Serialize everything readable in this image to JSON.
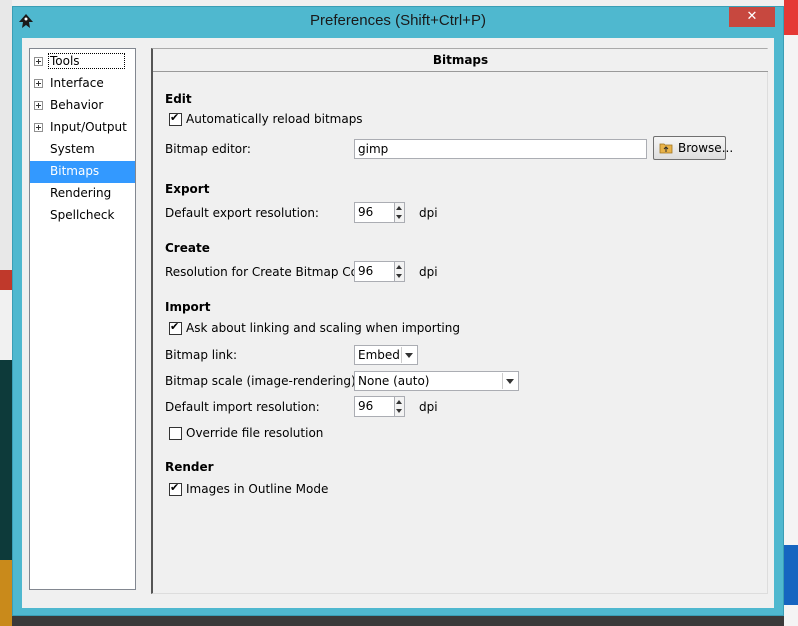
{
  "window": {
    "title": "Preferences (Shift+Ctrl+P)",
    "close_label": "✕"
  },
  "tree": {
    "items": [
      {
        "label": "Tools",
        "expandable": true
      },
      {
        "label": "Interface",
        "expandable": true
      },
      {
        "label": "Behavior",
        "expandable": true
      },
      {
        "label": "Input/Output",
        "expandable": true
      },
      {
        "label": "System",
        "expandable": false
      },
      {
        "label": "Bitmaps",
        "expandable": false,
        "selected": true
      },
      {
        "label": "Rendering",
        "expandable": false
      },
      {
        "label": "Spellcheck",
        "expandable": false
      }
    ]
  },
  "page": {
    "header": "Bitmaps",
    "edit": {
      "heading": "Edit",
      "auto_reload_label": "Automatically reload bitmaps",
      "auto_reload_checked": true,
      "editor_label": "Bitmap editor:",
      "editor_value": "gimp",
      "browse_label": "Browse..."
    },
    "export": {
      "heading": "Export",
      "resolution_label": "Default export resolution:",
      "resolution_value": "96",
      "unit": "dpi"
    },
    "create": {
      "heading": "Create",
      "resolution_label": "Resolution for Create Bitmap Copy:",
      "resolution_value": "96",
      "unit": "dpi"
    },
    "import": {
      "heading": "Import",
      "ask_label": "Ask about linking and scaling when importing",
      "ask_checked": true,
      "link_label": "Bitmap link:",
      "link_value": "Embed",
      "scale_label": "Bitmap scale (image-rendering):",
      "scale_value": "None (auto)",
      "resolution_label": "Default import resolution:",
      "resolution_value": "96",
      "unit": "dpi",
      "override_label": "Override file resolution",
      "override_checked": false
    },
    "render": {
      "heading": "Render",
      "outline_label": "Images in Outline Mode",
      "outline_checked": true
    }
  },
  "colors": {
    "titlebar": "#4fb8cf",
    "selection": "#3399ff",
    "close": "#c7483f"
  }
}
